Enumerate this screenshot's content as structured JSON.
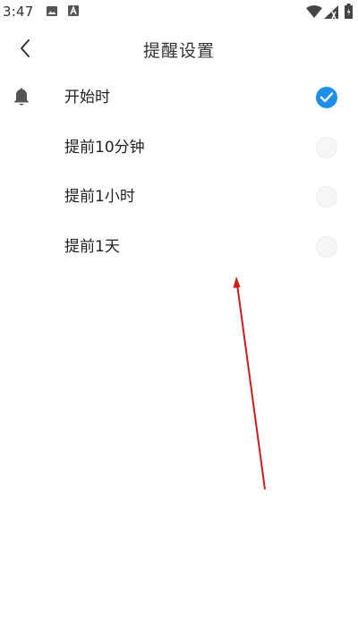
{
  "status_bar": {
    "time": "3:47",
    "icons": [
      "image-icon",
      "a-icon",
      "wifi-icon",
      "signal-icon",
      "battery-icon"
    ]
  },
  "app_bar": {
    "back_icon": "chevron-left-icon",
    "title": "提醒设置"
  },
  "options": [
    {
      "label": "开始时",
      "checked": true,
      "icon": "bell-icon"
    },
    {
      "label": "提前10分钟",
      "checked": false
    },
    {
      "label": "提前1小时",
      "checked": false
    },
    {
      "label": "提前1天",
      "checked": false
    }
  ],
  "colors": {
    "accent": "#1e8fe6",
    "arrow": "#d11a1a",
    "bell": "#555555"
  }
}
